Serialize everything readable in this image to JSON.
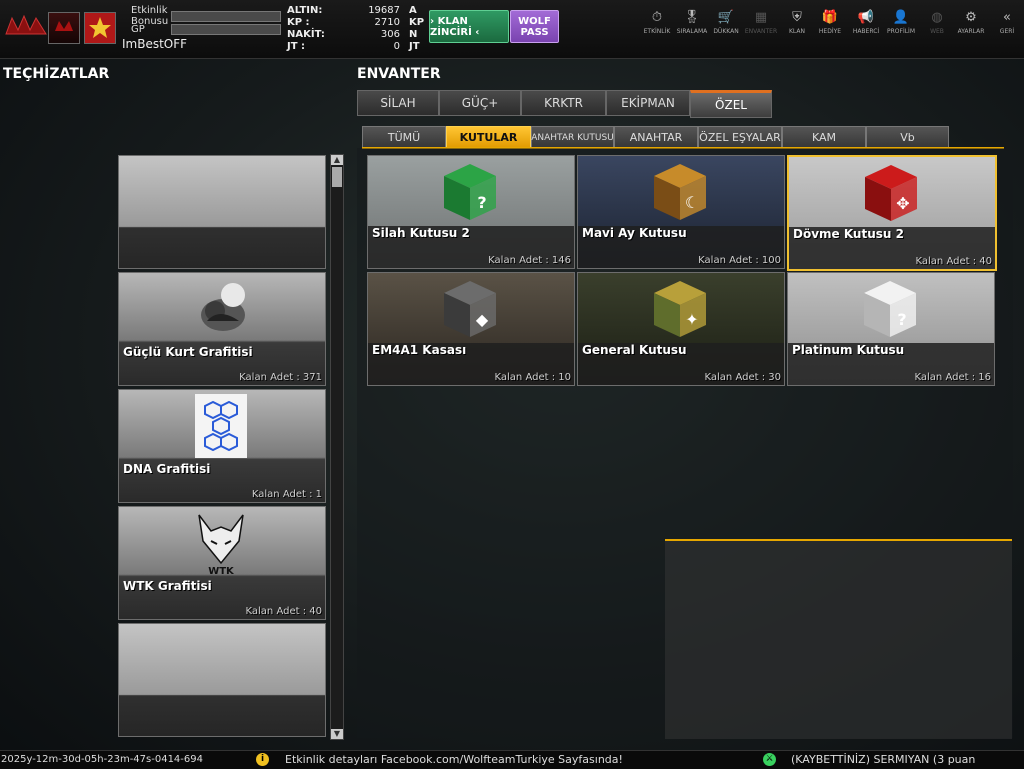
{
  "top": {
    "profile": {
      "event_bonus_label": "Etkinlik\nBonusu",
      "gp_label": "GP",
      "username": "ImBestOFF",
      "event_bonus_progress": 0,
      "gp_progress": 0
    },
    "currency": [
      {
        "label": "ALTIN:",
        "value": "19687",
        "unit": "A"
      },
      {
        "label": "KP  :",
        "value": "2710",
        "unit": "KP"
      },
      {
        "label": "NAKİT:",
        "value": "306",
        "unit": "N"
      },
      {
        "label": "JT  :",
        "value": "0",
        "unit": "JT"
      }
    ],
    "klan_chain_label": "› KLAN ZİNCİRİ ‹",
    "wolf_pass_label": "WOLF PASS",
    "nav": [
      {
        "label": "ETKİNLİK",
        "icon": "stopwatch-icon",
        "glyph": "⏱",
        "enabled": true
      },
      {
        "label": "SIRALAMA",
        "icon": "medal-icon",
        "glyph": "🎖",
        "enabled": true
      },
      {
        "label": "DÜKKAN",
        "icon": "cart-icon",
        "glyph": "🛒",
        "enabled": true
      },
      {
        "label": "ENVANTER",
        "icon": "inventory-icon",
        "glyph": "▦",
        "enabled": false
      },
      {
        "label": "KLAN",
        "icon": "shield-icon",
        "glyph": "⛨",
        "enabled": true
      },
      {
        "label": "HEDİYE",
        "icon": "gift-icon",
        "glyph": "🎁",
        "enabled": true
      },
      {
        "label": "HABERCİ",
        "icon": "megaphone-icon",
        "glyph": "📢",
        "enabled": true
      },
      {
        "label": "PROFİLİM",
        "icon": "profile-icon",
        "glyph": "👤",
        "enabled": true
      },
      {
        "label": "WEB",
        "icon": "globe-icon",
        "glyph": "◍",
        "enabled": false
      },
      {
        "label": "AYARLAR",
        "icon": "gear-icon",
        "glyph": "⚙",
        "enabled": true
      },
      {
        "label": "GERİ",
        "icon": "back-chevron-icon",
        "glyph": "«",
        "enabled": true
      }
    ]
  },
  "equipment": {
    "title": "TEÇHİZATLAR",
    "slots": [
      {
        "name": "",
        "qty": ""
      },
      {
        "name": "Güçlü Kurt Grafitisi",
        "qty": "Kalan Adet : 371",
        "icon": "wolf-statue-icon"
      },
      {
        "name": "DNA Grafitisi",
        "qty": "Kalan Adet : 1",
        "icon": "dna-pattern-icon"
      },
      {
        "name": "WTK Grafitisi",
        "qty": "Kalan Adet : 40",
        "icon": "wtk-wolf-icon"
      },
      {
        "name": "",
        "qty": ""
      }
    ]
  },
  "inventory": {
    "title": "ENVANTER",
    "tabs": [
      {
        "label": "SİLAH",
        "active": false
      },
      {
        "label": "GÜÇ+",
        "active": false
      },
      {
        "label": "KRKTR",
        "active": false
      },
      {
        "label": "EKİPMAN",
        "active": false
      },
      {
        "label": "ÖZEL",
        "active": true
      }
    ],
    "subtabs": [
      {
        "label": "TÜMÜ",
        "active": false
      },
      {
        "label": "KUTULAR",
        "active": true
      },
      {
        "label": "ANAHTAR KUTUSU",
        "active": false
      },
      {
        "label": "ANAHTAR",
        "active": false
      },
      {
        "label": "ÖZEL EŞYALAR",
        "active": false
      },
      {
        "label": "KAM",
        "active": false
      },
      {
        "label": "Vb",
        "active": false
      }
    ],
    "items": [
      {
        "name": "Silah Kutusu 2",
        "qty": "Kalan Adet : 146",
        "icon": "green-weapon-box-icon",
        "selected": false
      },
      {
        "name": "Mavi Ay Kutusu",
        "qty": "Kalan Adet : 100",
        "icon": "blue-moon-chest-icon",
        "selected": false
      },
      {
        "name": "Dövme Kutusu 2",
        "qty": "Kalan Adet : 40",
        "icon": "red-tattoo-box-icon",
        "selected": true
      },
      {
        "name": "EM4A1 Kasası",
        "qty": "Kalan Adet : 10",
        "icon": "weapon-case-icon",
        "selected": false
      },
      {
        "name": "General Kutusu",
        "qty": "Kalan Adet : 30",
        "icon": "general-box-icon",
        "selected": false
      },
      {
        "name": "Platinum Kutusu",
        "qty": "Kalan Adet : 16",
        "icon": "platinum-box-icon",
        "selected": false
      }
    ]
  },
  "ticker": {
    "timestamp": "2025y-12m-30d-05h-23m-47s-0414-694",
    "message1": "Etkinlik detayları Facebook.com/WolfteamTurkiye Sayfasında!",
    "message2": "(KAYBETTİNİZ) SERMIYAN (3 puan"
  },
  "colors": {
    "accent": "#e6a700",
    "tab_active_bar": "#e07020",
    "klan_green": "#2f9a63",
    "wolf_purple": "#a26bd6"
  }
}
